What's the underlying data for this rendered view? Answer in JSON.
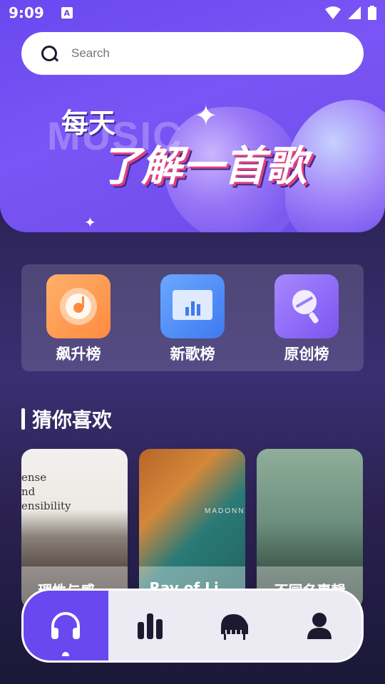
{
  "status_bar": {
    "time": "9:09",
    "badge": "A"
  },
  "search": {
    "placeholder": "Search"
  },
  "banner": {
    "background_word": "MUSIC",
    "slogan_top": "每天",
    "slogan_main": "了解一首歌"
  },
  "charts": [
    {
      "label": "飙升榜",
      "icon": "disc-icon",
      "color": "#ff9a50"
    },
    {
      "label": "新歌榜",
      "icon": "bar-chart-icon",
      "color": "#4f8af5"
    },
    {
      "label": "原创榜",
      "icon": "microphone-icon",
      "color": "#9370f8"
    }
  ],
  "recommend": {
    "title": "猜你喜欢",
    "items": [
      {
        "label": "理性与感..."
      },
      {
        "label": "Ray of Li..."
      },
      {
        "label": "不同名專輯"
      }
    ],
    "art_text": [
      "ense",
      "nd",
      "ensibility"
    ]
  },
  "art2_caption": "MADONNA",
  "tabs": [
    {
      "name": "headphones-icon",
      "active": true
    },
    {
      "name": "bar-chart-icon",
      "active": false
    },
    {
      "name": "piano-icon",
      "active": false
    },
    {
      "name": "user-icon",
      "active": false
    }
  ],
  "colors": {
    "accent": "#6a48f0",
    "orange": "#ff9a50",
    "blue": "#4f8af5",
    "purple": "#9370f8"
  }
}
